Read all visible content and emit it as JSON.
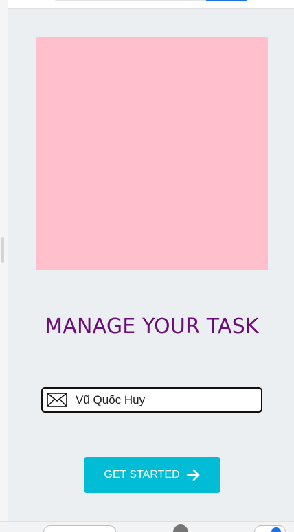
{
  "colors": {
    "background": "#eceff1",
    "hero": "#ffc0cb",
    "title": "#6a0d7a",
    "button": "#00bcd4",
    "button_text": "#ffffff"
  },
  "header": {
    "title": "MANAGE YOUR TASK"
  },
  "form": {
    "name_value": "Vũ Quốc Huy",
    "field_icon": "envelope-icon"
  },
  "actions": {
    "get_started_label": "GET STARTED",
    "get_started_icon": "arrow-right-icon"
  }
}
